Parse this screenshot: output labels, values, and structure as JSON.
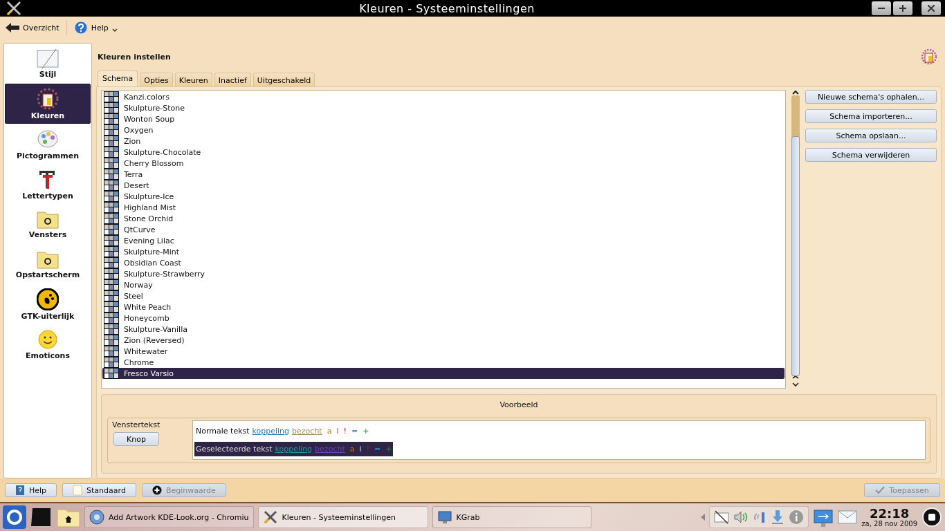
{
  "window": {
    "title": "Kleuren - Systeeminstellingen"
  },
  "toolbar": {
    "back": "Overzicht",
    "help": "Help"
  },
  "sidebar": {
    "items": [
      {
        "label": "Stijl",
        "kind": "style",
        "selected": false
      },
      {
        "label": "Kleuren",
        "kind": "colors",
        "selected": true
      },
      {
        "label": "Pictogrammen",
        "kind": "icons",
        "selected": false
      },
      {
        "label": "Lettertypen",
        "kind": "fonts",
        "selected": false
      },
      {
        "label": "Vensters",
        "kind": "folder",
        "selected": false
      },
      {
        "label": "Opstartscherm",
        "kind": "folder",
        "selected": false
      },
      {
        "label": "GTK-uiterlijk",
        "kind": "gtk",
        "selected": false
      },
      {
        "label": "Emoticons",
        "kind": "smiley",
        "selected": false
      }
    ]
  },
  "page": {
    "title": "Kleuren instellen"
  },
  "tabs": [
    {
      "label": "Schema",
      "selected": true
    },
    {
      "label": "Opties",
      "selected": false
    },
    {
      "label": "Kleuren",
      "selected": false
    },
    {
      "label": "Inactief",
      "selected": false
    },
    {
      "label": "Uitgeschakeld",
      "selected": false
    }
  ],
  "schemes": [
    {
      "name": "Kanzi.colors",
      "selected": false
    },
    {
      "name": "Skulpture-Stone",
      "selected": false
    },
    {
      "name": "Wonton Soup",
      "selected": false
    },
    {
      "name": "Oxygen",
      "selected": false
    },
    {
      "name": "Zion",
      "selected": false
    },
    {
      "name": "Skulpture-Chocolate",
      "selected": false
    },
    {
      "name": "Cherry Blossom",
      "selected": false
    },
    {
      "name": "Terra",
      "selected": false
    },
    {
      "name": "Desert",
      "selected": false
    },
    {
      "name": "Skulpture-Ice",
      "selected": false
    },
    {
      "name": "Highland Mist",
      "selected": false
    },
    {
      "name": "Stone Orchid",
      "selected": false
    },
    {
      "name": "QtCurve",
      "selected": false
    },
    {
      "name": "Evening Lilac",
      "selected": false
    },
    {
      "name": "Skulpture-Mint",
      "selected": false
    },
    {
      "name": "Obsidian Coast",
      "selected": false
    },
    {
      "name": "Skulpture-Strawberry",
      "selected": false
    },
    {
      "name": "Norway",
      "selected": false
    },
    {
      "name": "Steel",
      "selected": false
    },
    {
      "name": "White Peach",
      "selected": false
    },
    {
      "name": "Honeycomb",
      "selected": false
    },
    {
      "name": "Skulpture-Vanilla",
      "selected": false
    },
    {
      "name": "Zion (Reversed)",
      "selected": false
    },
    {
      "name": "Whitewater",
      "selected": false
    },
    {
      "name": "Chrome",
      "selected": false
    },
    {
      "name": "Fresco Varsio",
      "selected": true
    }
  ],
  "scheme_buttons": [
    "Nieuwe schema's ophalen...",
    "Schema importeren...",
    "Schema opslaan...",
    "Schema verwijderen"
  ],
  "preview": {
    "title": "Voorbeeld",
    "label": "Venstertekst",
    "button": "Knop",
    "normal": [
      {
        "text": "Normale tekst",
        "kind": "text"
      },
      {
        "text": "koppeling",
        "kind": "link"
      },
      {
        "text": "bezocht",
        "kind": "visited"
      },
      {
        "text": "a",
        "kind": "active"
      },
      {
        "text": "i",
        "kind": "inactive"
      },
      {
        "text": "!",
        "kind": "negative"
      },
      {
        "text": "=",
        "kind": "neutral"
      },
      {
        "text": "+",
        "kind": "positive"
      }
    ],
    "selected": [
      {
        "text": "Geselecteerde tekst",
        "kind": "text"
      },
      {
        "text": "koppeling",
        "kind": "link"
      },
      {
        "text": "bezocht",
        "kind": "visited"
      },
      {
        "text": "a",
        "kind": "active"
      },
      {
        "text": "i",
        "kind": "inactive"
      },
      {
        "text": "!",
        "kind": "negative"
      },
      {
        "text": "=",
        "kind": "neutral"
      },
      {
        "text": "+",
        "kind": "positive"
      }
    ]
  },
  "footer": {
    "buttons": [
      {
        "label": "Help",
        "kind": "help",
        "disabled": false
      },
      {
        "label": "Standaard",
        "kind": "default",
        "disabled": false
      },
      {
        "label": "Beginwaarde",
        "kind": "reset",
        "disabled": true
      }
    ],
    "apply": {
      "label": "Toepassen",
      "disabled": true
    }
  },
  "taskbar": {
    "tasks": [
      {
        "label": "Add Artwork KDE-Look.org - Chromiu",
        "kind": "browser",
        "selected": false
      },
      {
        "label": "Kleuren - Systeeminstellingen",
        "kind": "settings",
        "selected": true
      },
      {
        "label": "KGrab",
        "kind": "screenshot",
        "selected": false
      }
    ],
    "time": "22:18",
    "date": "za, 28 nov 2009"
  }
}
